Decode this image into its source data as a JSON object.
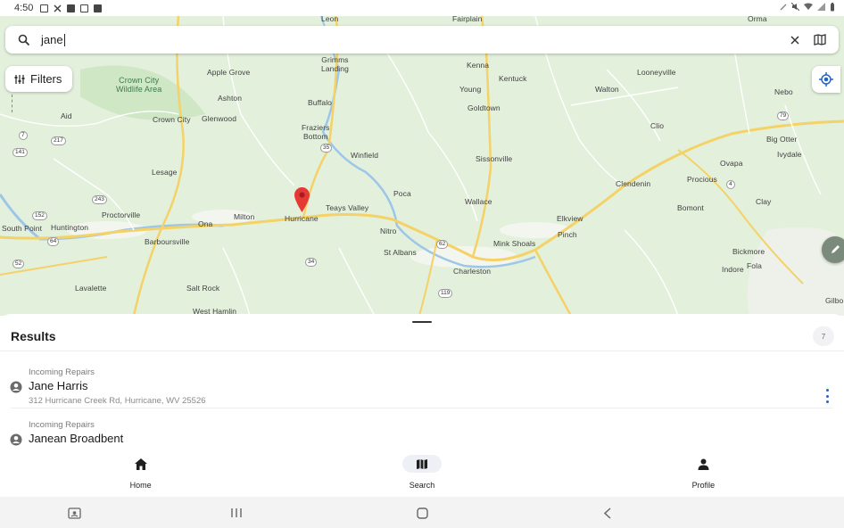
{
  "status_bar": {
    "time": "4:50"
  },
  "search": {
    "query": "jane"
  },
  "filters": {
    "label": "Filters"
  },
  "map_labels": {
    "towns": [
      "Leon",
      "Fairplain",
      "Orma",
      "Grimms\nLanding",
      "Kenna",
      "Looneyville",
      "Apple Grove",
      "Kentuck",
      "Ashton",
      "Young",
      "Walton",
      "Nebo",
      "Buffalo",
      "Goldtown",
      "Aid",
      "Crown City",
      "Glenwood",
      "Clio",
      "Fraziers\nBottom",
      "Big Otter",
      "Winfield",
      "Sissonville",
      "Ivydale",
      "Lesage",
      "Ovapa",
      "Procious",
      "Clendenin",
      "Poca",
      "Wallace",
      "Clay",
      "Teays Valley",
      "Bomont",
      "Proctorville",
      "Ona",
      "Milton",
      "Hurricane",
      "Elkview",
      "South Point",
      "Huntington",
      "Nitro",
      "Pinch",
      "Barboursville",
      "Mink Shoals",
      "Bickmore",
      "St Albans",
      "Fola",
      "Indore",
      "Charleston",
      "Lavalette",
      "Salt Rock",
      "West Hamlin",
      "Gilbo"
    ],
    "parks": [
      "Crown City\nWildlife Area"
    ],
    "routes": [
      "217",
      "7",
      "141",
      "35",
      "79",
      "243",
      "4",
      "64",
      "52",
      "62",
      "34",
      "119",
      "152"
    ]
  },
  "results": {
    "title": "Results",
    "count": "7",
    "items": [
      {
        "category": "Incoming Repairs",
        "name": "Jane Harris",
        "address": "312 Hurricane Creek Rd, Hurricane, WV 25526"
      },
      {
        "category": "Incoming Repairs",
        "name": "Janean Broadbent",
        "address": ""
      }
    ]
  },
  "bottom_nav": {
    "items": [
      {
        "label": "Home",
        "icon": "home-icon"
      },
      {
        "label": "Search",
        "icon": "map-icon",
        "active": true
      },
      {
        "label": "Profile",
        "icon": "person-icon"
      }
    ]
  },
  "colors": {
    "map_bg": "#e3f0dc",
    "road_major": "#f4d267",
    "road_minor": "#ffffff",
    "water": "#9ec6e8",
    "accent": "#2563c9",
    "marker": "#e53935"
  }
}
